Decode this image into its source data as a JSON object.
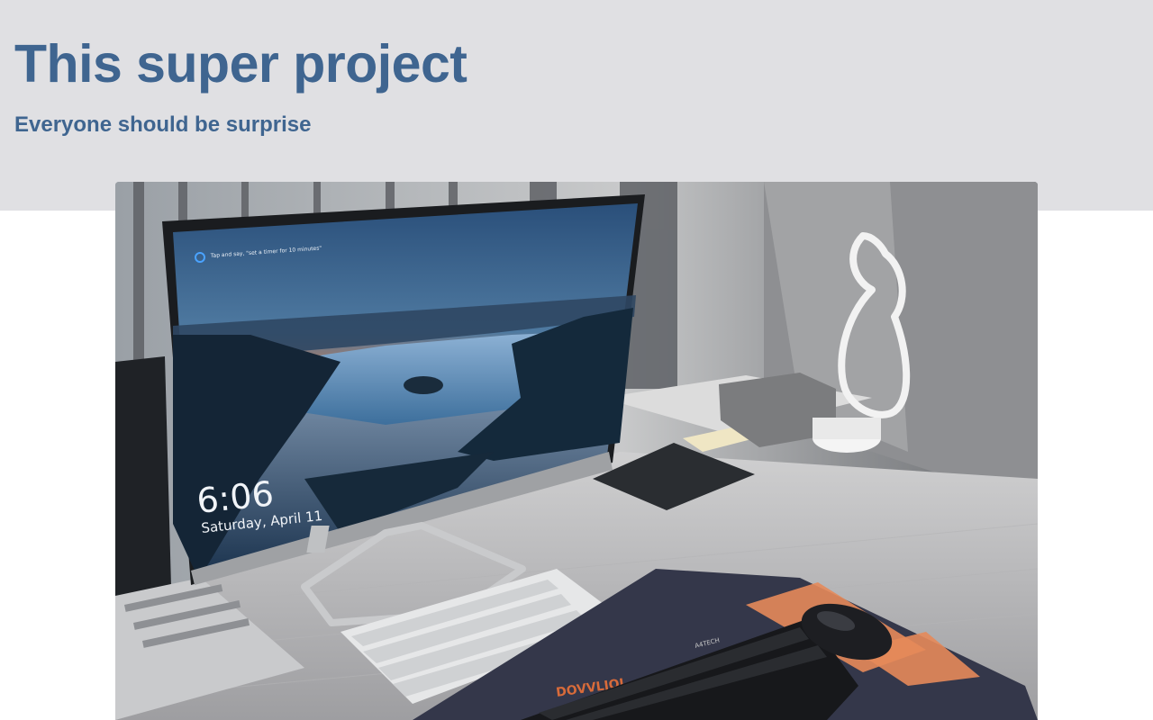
{
  "header": {
    "title": "This super project",
    "subtitle": "Everyone should be surprise"
  },
  "hero_image": {
    "alt": "desk-setup-photo",
    "screen_time": "6:06",
    "screen_date": "Saturday, April 11",
    "screen_prompt": "Tap and say, \"set a timer for 10 minutes\"",
    "mousepad_text": "DOVVLJOI",
    "keyboard_brand": "A4TECH"
  },
  "colors": {
    "band": "#e0e0e3",
    "heading": "#3f6590"
  }
}
